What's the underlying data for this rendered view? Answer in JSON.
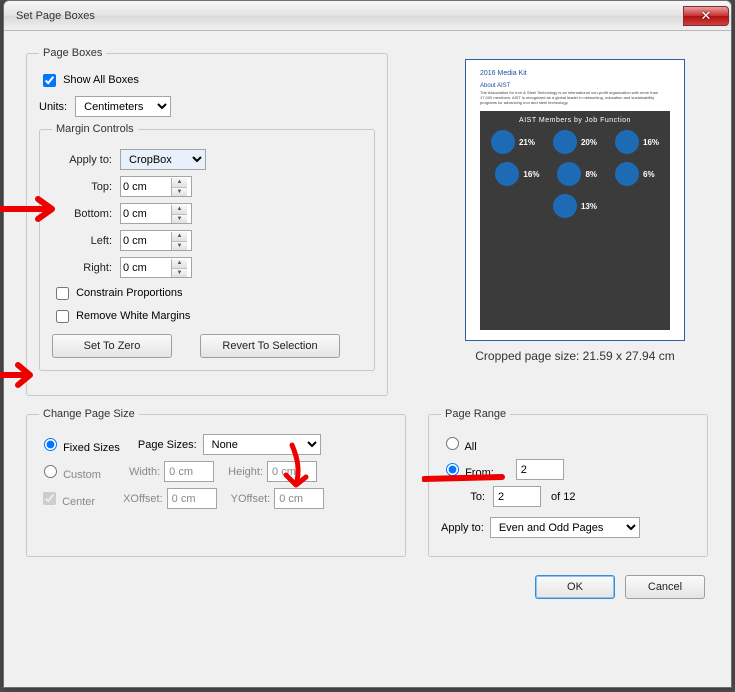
{
  "window": {
    "title": "Set Page Boxes"
  },
  "pageBoxes": {
    "legend": "Page Boxes",
    "showAll": "Show All Boxes",
    "unitsLabel": "Units:",
    "unitsValue": "Centimeters",
    "marginControls": {
      "legend": "Margin Controls",
      "applyToLabel": "Apply to:",
      "applyToValue": "CropBox",
      "top": {
        "label": "Top:",
        "value": "0 cm"
      },
      "bottom": {
        "label": "Bottom:",
        "value": "0 cm"
      },
      "left": {
        "label": "Left:",
        "value": "0 cm"
      },
      "right": {
        "label": "Right:",
        "value": "0 cm"
      },
      "constrain": "Constrain Proportions",
      "removeWhite": "Remove White Margins",
      "setZero": "Set To Zero",
      "revert": "Revert To Selection"
    }
  },
  "changePageSize": {
    "legend": "Change Page Size",
    "fixedSizes": "Fixed Sizes",
    "pageSizesLabel": "Page Sizes:",
    "pageSizesValue": "None",
    "custom": "Custom",
    "widthLabel": "Width:",
    "widthValue": "0 cm",
    "heightLabel": "Height:",
    "heightValue": "0 cm",
    "center": "Center",
    "xoffLabel": "XOffset:",
    "xoffValue": "0 cm",
    "yoffLabel": "YOffset:",
    "yoffValue": "0 cm"
  },
  "pageRange": {
    "legend": "Page Range",
    "all": "All",
    "fromLabel": "From:",
    "fromValue": "2",
    "toLabel": "To:",
    "toValue": "2",
    "ofLabel": "of 12",
    "applyToLabel": "Apply to:",
    "applyToValue": "Even and Odd Pages"
  },
  "preview": {
    "heading": "2016 Media Kit",
    "sub": "About AIST",
    "darkTitle": "AIST Members by Job Function",
    "pcts": [
      "21%",
      "20%",
      "16%",
      "16%",
      "8%",
      "6%",
      "13%"
    ],
    "caption": "Cropped page size: 21.59 x 27.94 cm"
  },
  "buttons": {
    "ok": "OK",
    "cancel": "Cancel"
  }
}
